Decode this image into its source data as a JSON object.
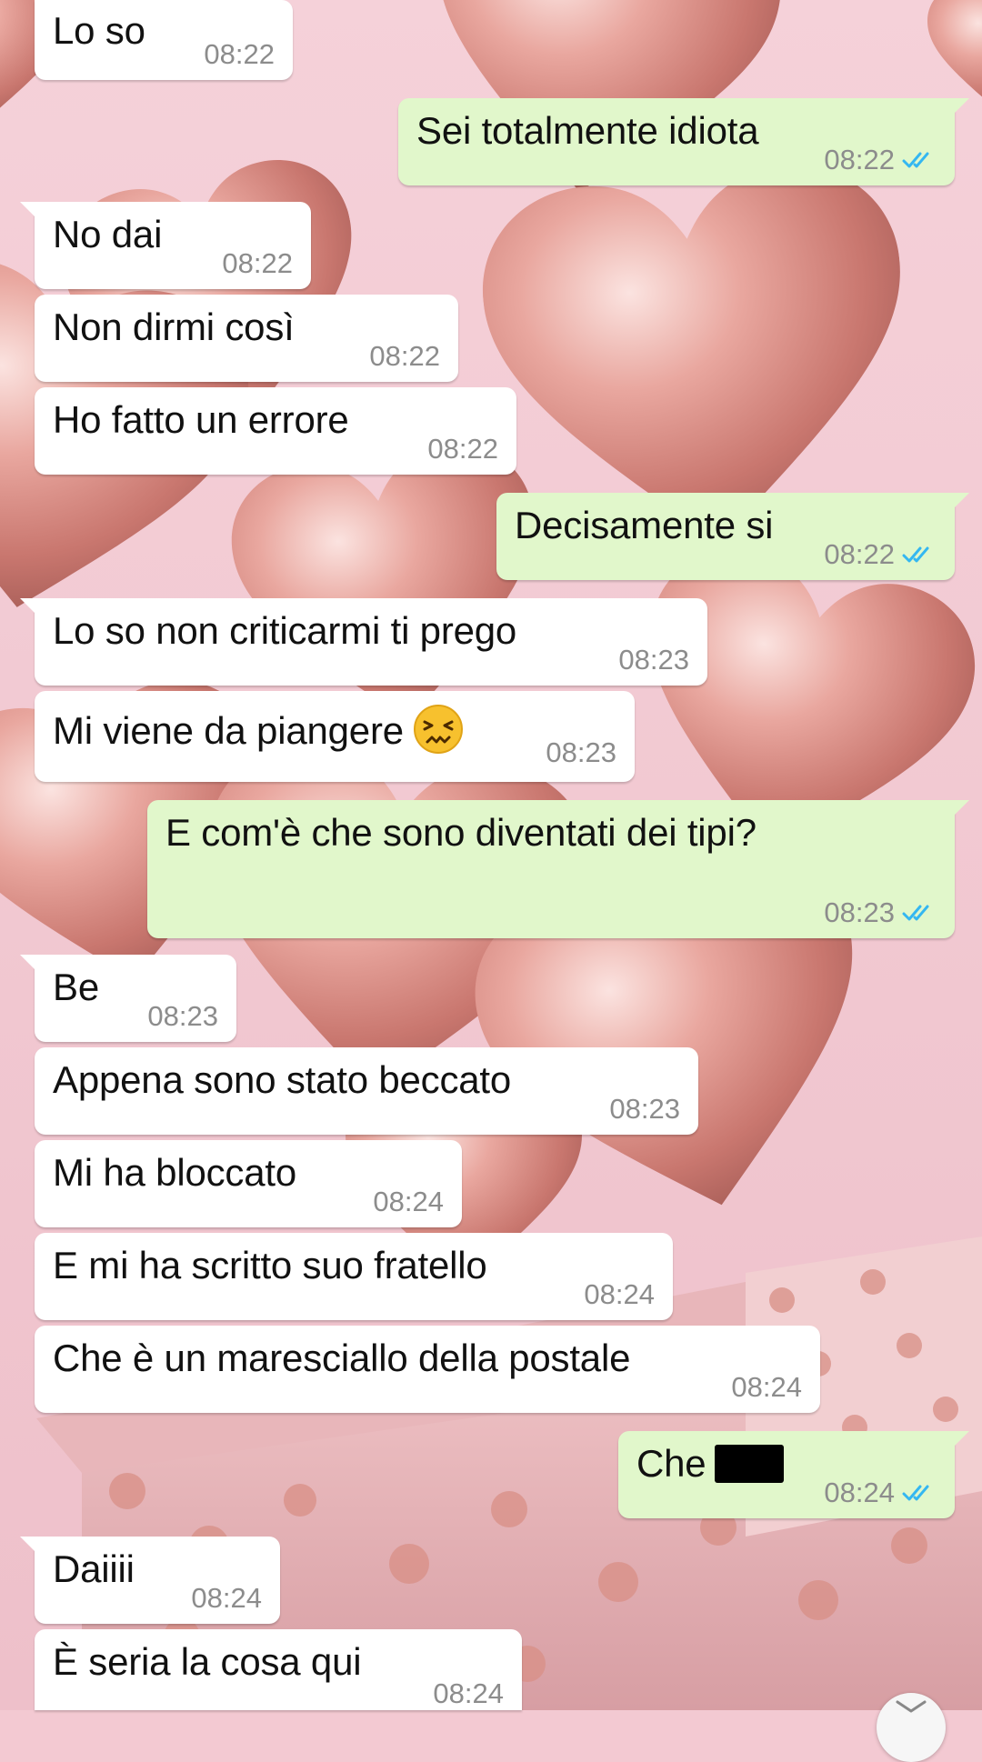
{
  "conversation": {
    "messages": [
      {
        "direction": "in",
        "text": "Lo so",
        "time": "08:22"
      },
      {
        "direction": "out",
        "text": "Sei totalmente idiota",
        "time": "08:22",
        "status": "read"
      },
      {
        "direction": "in",
        "text": "No dai",
        "time": "08:22"
      },
      {
        "direction": "in",
        "text": "Non dirmi così",
        "time": "08:22"
      },
      {
        "direction": "in",
        "text": "Ho fatto un errore",
        "time": "08:22"
      },
      {
        "direction": "out",
        "text": "Decisamente si",
        "time": "08:22",
        "status": "read"
      },
      {
        "direction": "in",
        "text": "Lo so non criticarmi ti prego",
        "time": "08:23"
      },
      {
        "direction": "in",
        "text": "Mi viene da piangere",
        "time": "08:23",
        "emoji": "confounded-face"
      },
      {
        "direction": "out",
        "text": "E com'è che sono diventati dei tipi?",
        "time": "08:23",
        "status": "read"
      },
      {
        "direction": "in",
        "text": "Be",
        "time": "08:23"
      },
      {
        "direction": "in",
        "text": "Appena sono stato beccato",
        "time": "08:23"
      },
      {
        "direction": "in",
        "text": "Mi ha bloccato",
        "time": "08:24"
      },
      {
        "direction": "in",
        "text": "E mi ha scritto suo fratello",
        "time": "08:24"
      },
      {
        "direction": "in",
        "text": "Che è un maresciallo della postale",
        "time": "08:24"
      },
      {
        "direction": "out",
        "text": "Che",
        "time": "08:24",
        "status": "read",
        "redacted": true
      },
      {
        "direction": "in",
        "text": "Daiiii",
        "time": "08:24"
      },
      {
        "direction": "in",
        "text": "È seria la cosa qui",
        "time": "08:24"
      }
    ]
  },
  "colors": {
    "incoming_bubble": "#ffffff",
    "outgoing_bubble": "#e1f7cb",
    "read_ticks": "#34b7f1",
    "timestamp": "#8c8c8c",
    "wallpaper": "#f3c9d2"
  },
  "icons": {
    "read_receipt": "double-check-icon",
    "scroll_down": "chevron-down-icon"
  }
}
